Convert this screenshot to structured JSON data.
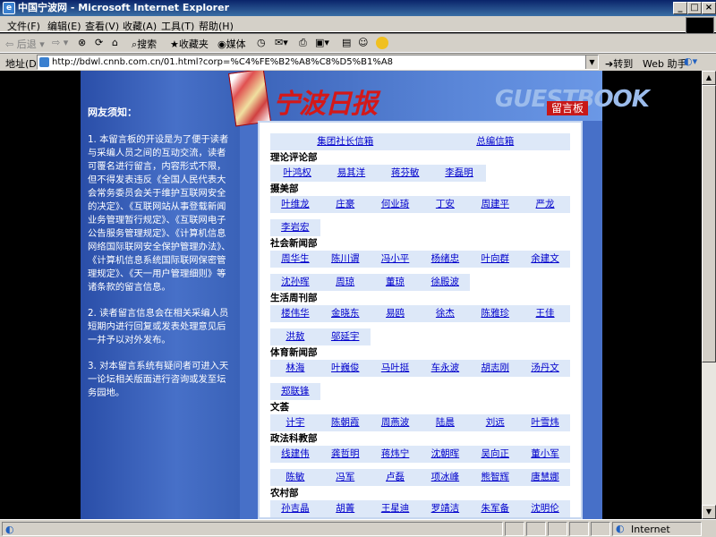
{
  "window": {
    "title": "中国宁波网 - Microsoft Internet Explorer"
  },
  "menu": [
    "文件(F)",
    "编辑(E)",
    "查看(V)",
    "收藏(A)",
    "工具(T)",
    "帮助(H)"
  ],
  "toolbar": {
    "back": "后退",
    "search": "搜索",
    "favorites": "收藏夹",
    "media": "媒体"
  },
  "address": {
    "label": "地址(D)",
    "url": "http://bdwl.cnnb.com.cn/01.html?corp=%C4%FE%B2%A8%C8%D5%B1%A8",
    "go": "转到",
    "web_help": "Web 助手"
  },
  "header": {
    "logo": "宁波日报",
    "guestbook": "GUESTBOOK",
    "tag": "留言板"
  },
  "sidebar": {
    "title": "网友须知：",
    "paras": [
      "1. 本留言板的开设是为了便于读者与采编人员之间的互动交流，读者可覆名进行留言，内容形式不限，但不得发表违反《全国人民代表大会常务委员会关于维护互联网安全的决定》、《互联网站从事登载新闻业务管理暂行规定》、《互联网电子公告服务管理规定》、《计算机信息网络国际联网安全保护管理办法》、《计算机信息系统国际联网保密管理规定》、《天一用户管理细则》等诸条款的留言信息。",
      "2. 读者留言信息会在相关采编人员短期内进行回复或发表处理意见后一并予以对外发布。",
      "3. 对本留言系统有疑问者可进入天一论坛相关版面进行咨询或发至坛务园地。"
    ]
  },
  "board": {
    "top": [
      "集团社长信箱",
      "总编信箱"
    ],
    "sections": [
      {
        "name": "理论评论部",
        "rows": [
          [
            "叶鸿权",
            "易其洋",
            "蒋芬敏",
            "李磊明"
          ]
        ]
      },
      {
        "name": "摄美部",
        "rows": [
          [
            "叶维龙",
            "庄豪",
            "何业琦",
            "丁安",
            "周建平",
            "严龙"
          ],
          [
            "李岩宏"
          ]
        ]
      },
      {
        "name": "社会新闻部",
        "rows": [
          [
            "周华生",
            "陈川谓",
            "冯小平",
            "杨绪忠",
            "叶向群",
            "余建文"
          ],
          [
            "沈孙晖",
            "周琼",
            "董琼",
            "徐殿波"
          ]
        ]
      },
      {
        "name": "生活周刊部",
        "rows": [
          [
            "楼伟华",
            "金晓东",
            "易鸥",
            "徐杰",
            "陈雅珍",
            "王佳"
          ],
          [
            "洪敖",
            "邬延宇"
          ]
        ]
      },
      {
        "name": "体育新闻部",
        "rows": [
          [
            "林海",
            "叶巍俊",
            "马叶挺",
            "车永波",
            "胡志刚",
            "汤丹文"
          ],
          [
            "郑联锋"
          ]
        ]
      },
      {
        "name": "文荟",
        "rows": [
          [
            "计宇",
            "陈朝霞",
            "周燕波",
            "陆晨",
            "刘远",
            "叶雪炜"
          ]
        ]
      },
      {
        "name": "政法科教部",
        "rows": [
          [
            "线建伟",
            "龚哲明",
            "蒋炜宁",
            "沈朝晖",
            "吴向正",
            "董小军"
          ],
          [
            "陈敏",
            "冯军",
            "卢磊",
            "项冰峰",
            "熊智辉",
            "唐慧娜"
          ]
        ]
      },
      {
        "name": "农村部",
        "rows": [
          [
            "孙吉晶",
            "胡菁",
            "王星迪",
            "罗靖洁",
            "朱军备",
            "沈明伦"
          ]
        ]
      }
    ]
  },
  "status": {
    "zone": "Internet"
  }
}
